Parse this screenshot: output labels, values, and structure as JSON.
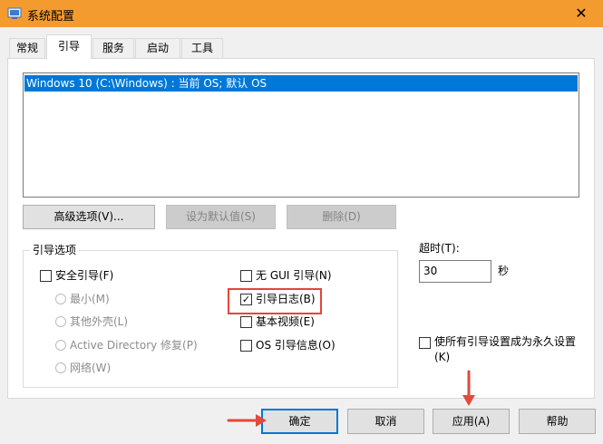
{
  "window": {
    "title": "系统配置",
    "close_glyph": "✕"
  },
  "tabs": [
    {
      "label": "常规"
    },
    {
      "label": "引导"
    },
    {
      "label": "服务"
    },
    {
      "label": "启动"
    },
    {
      "label": "工具"
    }
  ],
  "os_list": {
    "items": [
      {
        "label": "Windows 10 (C:\\Windows) : 当前 OS; 默认 OS"
      }
    ]
  },
  "list_buttons": {
    "advanced": "高级选项(V)...",
    "set_default": "设为默认值(S)",
    "delete": "删除(D)"
  },
  "boot_options": {
    "group_label": "引导选项",
    "safe_boot": {
      "label": "安全引导(F)",
      "checked": false
    },
    "radios": [
      {
        "label": "最小(M)"
      },
      {
        "label": "其他外壳(L)"
      },
      {
        "label": "Active Directory 修复(P)"
      },
      {
        "label": "网络(W)"
      }
    ],
    "no_gui": {
      "label": "无 GUI 引导(N)",
      "checked": false
    },
    "boot_log": {
      "label": "引导日志(B)",
      "checked": true
    },
    "base_video": {
      "label": "基本视频(E)",
      "checked": false
    },
    "os_boot_info": {
      "label": "OS 引导信息(O)",
      "checked": false
    }
  },
  "timeout": {
    "label": "超时(T):",
    "value": "30",
    "unit": "秒"
  },
  "permanent": {
    "label_line1": "使所有引导设置成为永久设置",
    "label_line2": "(K)",
    "checked": false
  },
  "footer": {
    "ok": "确定",
    "cancel": "取消",
    "apply": "应用(A)",
    "help": "帮助"
  },
  "check_glyph": "✓",
  "colors": {
    "titlebar": "#f49b2f",
    "selection": "#0078d7",
    "annotation": "#e24a3b"
  }
}
